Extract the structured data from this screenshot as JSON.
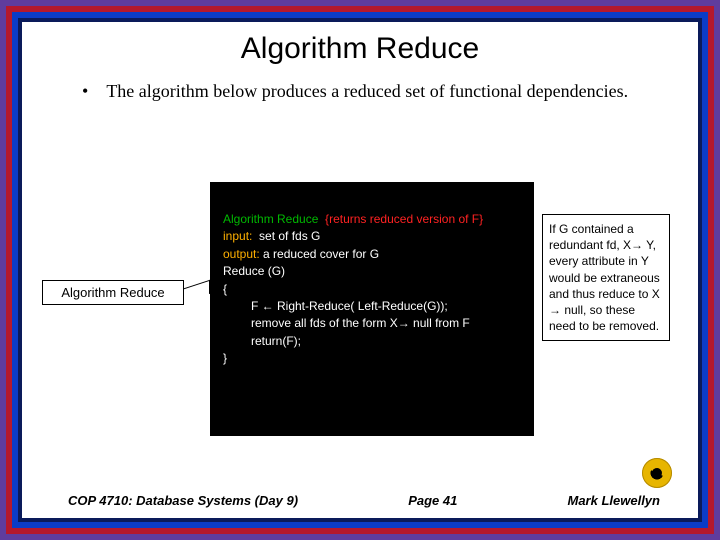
{
  "title": "Algorithm Reduce",
  "intro": {
    "bullet": "•",
    "text": "The algorithm below produces a reduced set of functional dependencies."
  },
  "algorithm": {
    "head": "Algorithm Reduce",
    "head_note": "  {returns reduced version of F}",
    "input_k": "input:",
    "input_v": "  set of fds G",
    "output_k": "output:",
    "output_v": " a reduced cover for G",
    "reduce": "Reduce (G)",
    "open": "{",
    "line1": "F ← Right-Reduce( Left-Reduce(G));",
    "line2": "remove all fds of the form X→ null from F",
    "line3": "return(F);",
    "close": "}"
  },
  "label": "Algorithm Reduce",
  "note": "If G contained a redundant fd, X→ Y, every attribute in Y would be extraneous and thus reduce to X → null, so these need to be removed.",
  "footer": {
    "left": "COP 4710: Database Systems  (Day 9)",
    "page": "Page 41",
    "author": "Mark Llewellyn"
  }
}
